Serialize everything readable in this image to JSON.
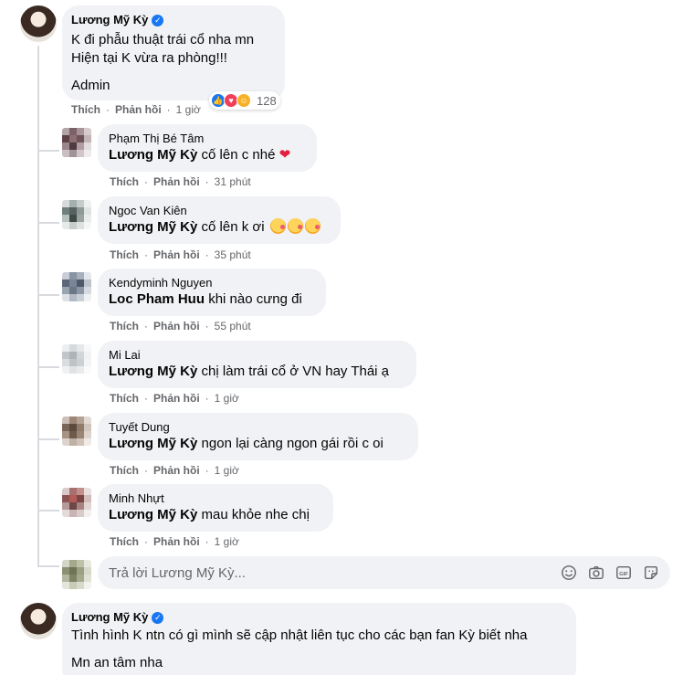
{
  "comment1": {
    "author": "Lương Mỹ Kỳ",
    "lines": [
      "K đi phẫu thuật trái cổ nha mn",
      "Hiện tại K vừa ra phòng!!!",
      "Admin"
    ],
    "reaction_count": "128",
    "actions": {
      "like": "Thích",
      "reply": "Phản hồi",
      "time": "1 giờ"
    }
  },
  "replies": [
    {
      "author": "Phạm Thị Bé Tâm",
      "mention": "Lương Mỹ Kỳ",
      "text": "cố lên c nhé",
      "emoji": "❤",
      "like": "Thích",
      "reply": "Phản hồi",
      "time": "31 phút"
    },
    {
      "author": "Ngoc Van Kiên",
      "mention": "Lương Mỹ Kỳ",
      "text": "cố lên k ơi",
      "like": "Thích",
      "reply": "Phản hồi",
      "time": "35 phút"
    },
    {
      "author": "Kendyminh Nguyen",
      "mention": "Loc Pham Huu",
      "text": "khi nào cưng đi",
      "like": "Thích",
      "reply": "Phản hồi",
      "time": "55 phút"
    },
    {
      "author": "Mi Lai",
      "mention": "Lương Mỹ Kỳ",
      "text": "chị làm trái cổ ở VN hay Thái ạ",
      "like": "Thích",
      "reply": "Phản hồi",
      "time": "1 giờ"
    },
    {
      "author": "Tuyết Dung",
      "mention": "Lương Mỹ Kỳ",
      "text": "ngon lại càng ngon gái rồi c oi",
      "like": "Thích",
      "reply": "Phản hồi",
      "time": "1 giờ"
    },
    {
      "author": "Minh Nhựt",
      "mention": "Lương Mỹ Kỳ",
      "text": "mau khỏe nhe chị",
      "like": "Thích",
      "reply": "Phản hồi",
      "time": "1 giờ"
    }
  ],
  "reply_input": {
    "placeholder": "Trả lời Lương Mỹ Kỳ..."
  },
  "comment2": {
    "author": "Lương Mỹ Kỳ",
    "lines": [
      "Tình hình K ntn có gì mình sẽ cập nhật liên tục cho các bạn fan Kỳ biết nha",
      "Mn an tâm nha"
    ]
  }
}
